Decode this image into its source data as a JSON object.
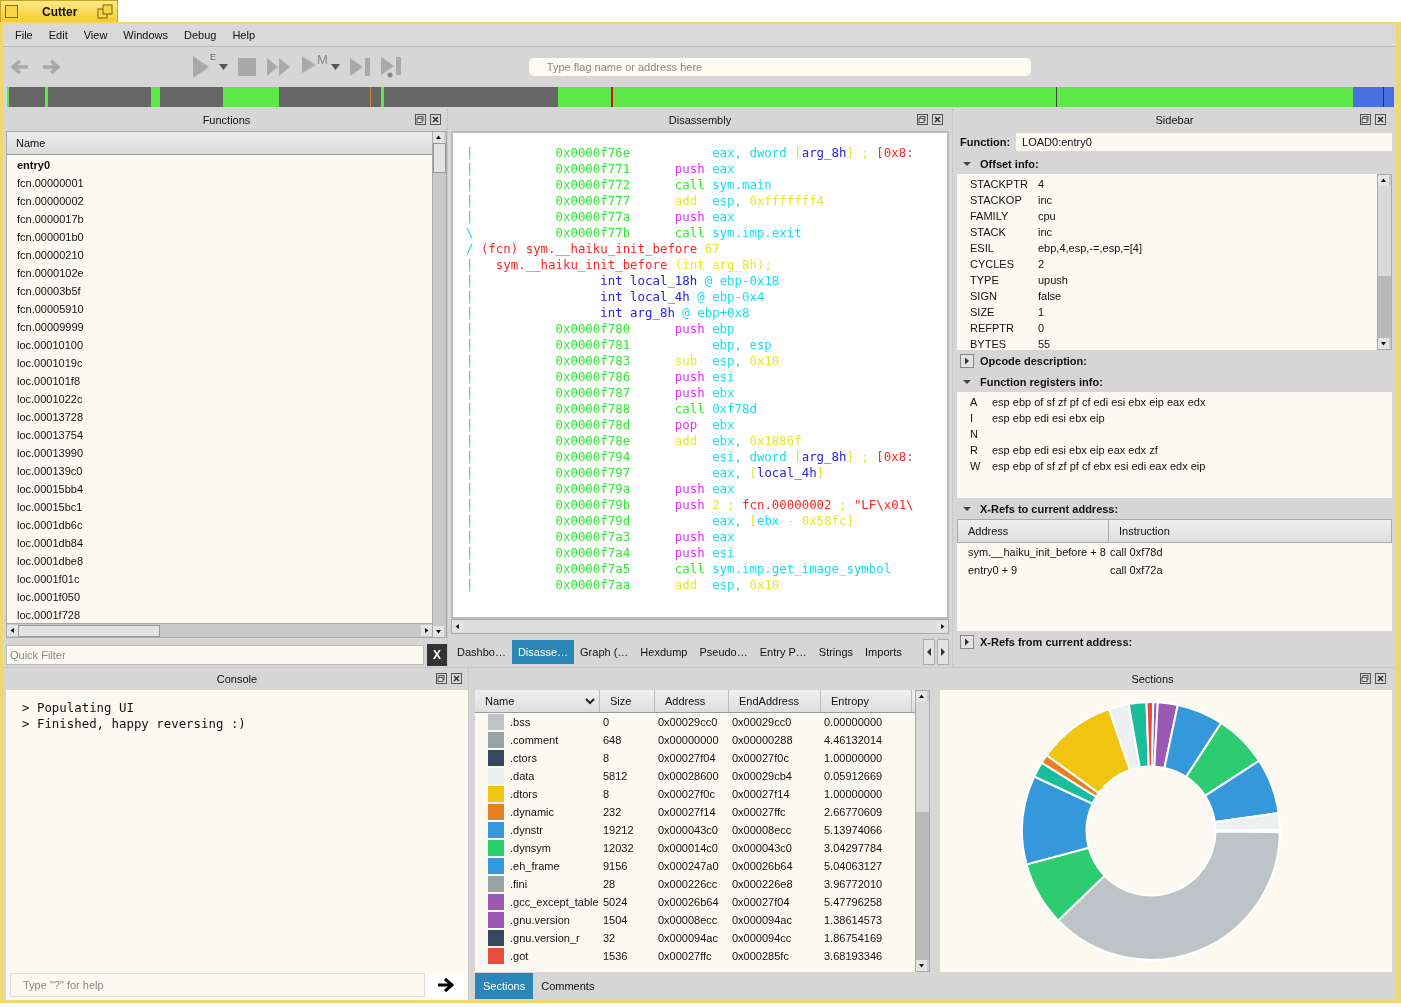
{
  "window": {
    "title": "Cutter"
  },
  "menu": [
    "File",
    "Edit",
    "View",
    "Windows",
    "Debug",
    "Help"
  ],
  "toolbar": {
    "run_badge": "E",
    "step_badge": "M",
    "search": {
      "placeholder": "Type flag name or address here"
    }
  },
  "functions": {
    "title": "Functions",
    "column": "Name",
    "items": [
      {
        "name": "entry0",
        "current": true
      },
      {
        "name": "fcn.00000001",
        "current": false
      },
      {
        "name": "fcn.00000002",
        "current": false
      },
      {
        "name": "fcn.0000017b",
        "current": false
      },
      {
        "name": "fcn.000001b0",
        "current": false
      },
      {
        "name": "fcn.00000210",
        "current": false
      },
      {
        "name": "fcn.0000102e",
        "current": false
      },
      {
        "name": "fcn.00003b5f",
        "current": false
      },
      {
        "name": "fcn.00005910",
        "current": false
      },
      {
        "name": "fcn.00009999",
        "current": false
      },
      {
        "name": "loc.00010100",
        "current": false
      },
      {
        "name": "loc.0001019c",
        "current": false
      },
      {
        "name": "loc.000101f8",
        "current": false
      },
      {
        "name": "loc.0001022c",
        "current": false
      },
      {
        "name": "loc.00013728",
        "current": false
      },
      {
        "name": "loc.00013754",
        "current": false
      },
      {
        "name": "loc.00013990",
        "current": false
      },
      {
        "name": "loc.000139c0",
        "current": false
      },
      {
        "name": "loc.00015bb4",
        "current": false
      },
      {
        "name": "loc.00015bc1",
        "current": false
      },
      {
        "name": "loc.0001db6c",
        "current": false
      },
      {
        "name": "loc.0001db84",
        "current": false
      },
      {
        "name": "loc.0001dbe8",
        "current": false
      },
      {
        "name": "loc.0001f01c",
        "current": false
      },
      {
        "name": "loc.0001f050",
        "current": false
      },
      {
        "name": "loc.0001f728",
        "current": false
      }
    ],
    "filter": {
      "placeholder": "Quick Filter"
    },
    "clear_button": "X"
  },
  "disassembly": {
    "title": "Disassembly",
    "lines": [
      {
        "kind": "instr",
        "gutter": "|",
        "addr": "0x0000f76e",
        "tokens": [
          {
            "text": "eax,",
            "kind": "reg"
          },
          {
            "text": "dword",
            "kind": "reg"
          },
          {
            "text": "[",
            "kind": "num"
          },
          {
            "text": "arg_8h",
            "kind": "var",
            "attached": true
          },
          {
            "text": "]",
            "kind": "num",
            "attached": true
          },
          {
            "text": ";",
            "kind": "num"
          },
          {
            "text": "[0x8:",
            "kind": "cmt"
          }
        ]
      },
      {
        "kind": "instr",
        "gutter": "|",
        "addr": "0x0000f771",
        "op": {
          "text": "push",
          "kind": "stack"
        },
        "tokens": [
          {
            "text": "eax",
            "kind": "reg"
          }
        ]
      },
      {
        "kind": "instr",
        "gutter": "|",
        "addr": "0x0000f772",
        "op": {
          "text": "call",
          "kind": "call"
        },
        "tokens": [
          {
            "text": "sym.main",
            "kind": "reg"
          }
        ]
      },
      {
        "kind": "instr",
        "gutter": "|",
        "addr": "0x0000f777",
        "op": {
          "text": "add",
          "kind": "arith"
        },
        "tokens": [
          {
            "text": "esp,",
            "kind": "reg"
          },
          {
            "text": "0xfffffff4",
            "kind": "num"
          }
        ]
      },
      {
        "kind": "instr",
        "gutter": "|",
        "addr": "0x0000f77a",
        "op": {
          "text": "push",
          "kind": "stack"
        },
        "tokens": [
          {
            "text": "eax",
            "kind": "reg"
          }
        ]
      },
      {
        "kind": "instr",
        "gutter": "\\",
        "addr": "0x0000f77b",
        "op": {
          "text": "call",
          "kind": "call"
        },
        "tokens": [
          {
            "text": "sym.imp.exit",
            "kind": "reg"
          }
        ]
      },
      {
        "kind": "header",
        "gutter": "/",
        "tokens": [
          {
            "text": "(fcn)",
            "kind": "cmt"
          },
          {
            "text": "sym.__haiku_init_before",
            "kind": "cmt"
          },
          {
            "text": "67",
            "kind": "num"
          }
        ]
      },
      {
        "kind": "signature",
        "gutter": "|",
        "tokens": [
          {
            "text": "sym.__haiku_init_before",
            "kind": "cmt"
          },
          {
            "text": "(int arg_8h);",
            "kind": "num"
          }
        ]
      },
      {
        "kind": "var",
        "gutter": "|",
        "tokens": [
          {
            "text": "int",
            "kind": "var"
          },
          {
            "text": "local_18h",
            "kind": "var"
          },
          {
            "text": "@",
            "kind": "reg"
          },
          {
            "text": "ebp-0x18",
            "kind": "reg"
          }
        ]
      },
      {
        "kind": "var",
        "gutter": "|",
        "tokens": [
          {
            "text": "int",
            "kind": "var"
          },
          {
            "text": "local_4h",
            "kind": "var"
          },
          {
            "text": "@",
            "kind": "reg"
          },
          {
            "text": "ebp-0x4",
            "kind": "reg"
          }
        ]
      },
      {
        "kind": "var",
        "gutter": "|",
        "tokens": [
          {
            "text": "int",
            "kind": "var"
          },
          {
            "text": "arg_8h",
            "kind": "var"
          },
          {
            "text": "@",
            "kind": "reg"
          },
          {
            "text": "ebp+0x8",
            "kind": "reg"
          }
        ]
      },
      {
        "kind": "instr",
        "gutter": "|",
        "addr": "0x0000f780",
        "op": {
          "text": "push",
          "kind": "stack"
        },
        "tokens": [
          {
            "text": "ebp",
            "kind": "reg"
          }
        ]
      },
      {
        "kind": "instr",
        "gutter": "|",
        "addr": "0x0000f781",
        "tokens": [
          {
            "text": "ebp,",
            "kind": "reg"
          },
          {
            "text": "esp",
            "kind": "reg"
          }
        ]
      },
      {
        "kind": "instr",
        "gutter": "|",
        "addr": "0x0000f783",
        "op": {
          "text": "sub",
          "kind": "arith"
        },
        "tokens": [
          {
            "text": "esp,",
            "kind": "reg"
          },
          {
            "text": "0x10",
            "kind": "num"
          }
        ]
      },
      {
        "kind": "instr",
        "gutter": "|",
        "addr": "0x0000f786",
        "op": {
          "text": "push",
          "kind": "stack"
        },
        "tokens": [
          {
            "text": "esi",
            "kind": "reg"
          }
        ]
      },
      {
        "kind": "instr",
        "gutter": "|",
        "addr": "0x0000f787",
        "op": {
          "text": "push",
          "kind": "stack"
        },
        "tokens": [
          {
            "text": "ebx",
            "kind": "reg"
          }
        ]
      },
      {
        "kind": "instr",
        "gutter": "|",
        "addr": "0x0000f788",
        "op": {
          "text": "call",
          "kind": "call"
        },
        "tokens": [
          {
            "text": "0xf78d",
            "kind": "reg"
          }
        ]
      },
      {
        "kind": "instr",
        "gutter": "|",
        "addr": "0x0000f78d",
        "op": {
          "text": "pop",
          "kind": "stack"
        },
        "tokens": [
          {
            "text": "ebx",
            "kind": "reg"
          }
        ]
      },
      {
        "kind": "instr",
        "gutter": "|",
        "addr": "0x0000f78e",
        "op": {
          "text": "add",
          "kind": "arith"
        },
        "tokens": [
          {
            "text": "ebx,",
            "kind": "reg"
          },
          {
            "text": "0x1886f",
            "kind": "num"
          }
        ]
      },
      {
        "kind": "instr",
        "gutter": "|",
        "addr": "0x0000f794",
        "tokens": [
          {
            "text": "esi,",
            "kind": "reg"
          },
          {
            "text": "dword",
            "kind": "reg"
          },
          {
            "text": "[",
            "kind": "num"
          },
          {
            "text": "arg_8h",
            "kind": "var",
            "attached": true
          },
          {
            "text": "]",
            "kind": "num",
            "attached": true
          },
          {
            "text": ";",
            "kind": "num"
          },
          {
            "text": "[0x8:",
            "kind": "cmt"
          }
        ]
      },
      {
        "kind": "instr",
        "gutter": "|",
        "addr": "0x0000f797",
        "tokens": [
          {
            "text": "eax,",
            "kind": "reg"
          },
          {
            "text": "[",
            "kind": "num"
          },
          {
            "text": "local_4h",
            "kind": "var",
            "attached": true
          },
          {
            "text": "]",
            "kind": "num",
            "attached": true
          }
        ]
      },
      {
        "kind": "instr",
        "gutter": "|",
        "addr": "0x0000f79a",
        "op": {
          "text": "push",
          "kind": "stack"
        },
        "tokens": [
          {
            "text": "eax",
            "kind": "reg"
          }
        ]
      },
      {
        "kind": "instr",
        "gutter": "|",
        "addr": "0x0000f79b",
        "op": {
          "text": "push",
          "kind": "stack"
        },
        "tokens": [
          {
            "text": "2",
            "kind": "num"
          },
          {
            "text": ";",
            "kind": "num"
          },
          {
            "text": "fcn.00000002",
            "kind": "cmt"
          },
          {
            "text": ";",
            "kind": "num"
          },
          {
            "text": "\"LF\\x01\\",
            "kind": "cmt"
          }
        ]
      },
      {
        "kind": "instr",
        "gutter": "|",
        "addr": "0x0000f79d",
        "tokens": [
          {
            "text": "eax,",
            "kind": "reg"
          },
          {
            "text": "[",
            "kind": "num"
          },
          {
            "text": "ebx",
            "kind": "reg",
            "attached": true
          },
          {
            "text": "-",
            "kind": "num"
          },
          {
            "text": "0x58fc",
            "kind": "num"
          },
          {
            "text": "]",
            "kind": "num",
            "attached": true
          }
        ]
      },
      {
        "kind": "instr",
        "gutter": "|",
        "addr": "0x0000f7a3",
        "op": {
          "text": "push",
          "kind": "stack"
        },
        "tokens": [
          {
            "text": "eax",
            "kind": "reg"
          }
        ]
      },
      {
        "kind": "instr",
        "gutter": "|",
        "addr": "0x0000f7a4",
        "op": {
          "text": "push",
          "kind": "stack"
        },
        "tokens": [
          {
            "text": "esi",
            "kind": "reg"
          }
        ]
      },
      {
        "kind": "instr",
        "gutter": "|",
        "addr": "0x0000f7a5",
        "op": {
          "text": "call",
          "kind": "call"
        },
        "tokens": [
          {
            "text": "sym.imp.get_image_symbol",
            "kind": "reg"
          }
        ]
      },
      {
        "kind": "instr",
        "gutter": "|",
        "addr": "0x0000f7aa",
        "op": {
          "text": "add",
          "kind": "arith"
        },
        "tokens": [
          {
            "text": "esp,",
            "kind": "reg"
          },
          {
            "text": "0x10",
            "kind": "num"
          }
        ]
      }
    ],
    "tabs": [
      {
        "label": "Dashbo…",
        "selected": false
      },
      {
        "label": "Disasse…",
        "selected": true
      },
      {
        "label": "Graph (…",
        "selected": false
      },
      {
        "label": "Hexdump",
        "selected": false
      },
      {
        "label": "Pseudo…",
        "selected": false
      },
      {
        "label": "Entry P…",
        "selected": false
      },
      {
        "label": "Strings",
        "selected": false
      },
      {
        "label": "Imports",
        "selected": false
      }
    ]
  },
  "sidebar": {
    "title": "Sidebar",
    "function_label": "Function:",
    "function_value": "LOAD0:entry0",
    "offset_info": {
      "title": "Offset info:",
      "expanded": true,
      "rows": [
        [
          "STACKPTR",
          "4"
        ],
        [
          "STACKOP",
          "inc"
        ],
        [
          "FAMILY",
          "cpu"
        ],
        [
          "STACK",
          "inc"
        ],
        [
          "ESIL",
          "ebp,4,esp,-=,esp,=[4]"
        ],
        [
          "CYCLES",
          "2"
        ],
        [
          "TYPE",
          "upush"
        ],
        [
          "SIGN",
          "false"
        ],
        [
          "SIZE",
          "1"
        ],
        [
          "REFPTR",
          "0"
        ],
        [
          "BYTES",
          "55"
        ]
      ]
    },
    "opcode_description": {
      "title": "Opcode description:",
      "expanded": false
    },
    "registers_info": {
      "title": "Function registers info:",
      "expanded": true,
      "rows": [
        [
          "A",
          "esp ebp of sf zf pf cf edi esi ebx eip eax edx"
        ],
        [
          "I",
          "esp ebp edi esi ebx eip"
        ],
        [
          "N",
          ""
        ],
        [
          "R",
          "esp ebp edi esi ebx eip eax edx zf"
        ],
        [
          "W",
          "esp ebp of sf zf pf cf ebx esi edi eax edx eip"
        ]
      ]
    },
    "xrefs_to": {
      "title": "X-Refs to current address:",
      "expanded": true,
      "columns": [
        "Address",
        "Instruction"
      ],
      "rows": [
        [
          "sym.__haiku_init_before + 8",
          "call 0xf78d"
        ],
        [
          "entry0 + 9",
          "call 0xf72a"
        ]
      ]
    },
    "xrefs_from": {
      "title": "X-Refs from current address:",
      "expanded": false
    }
  },
  "console": {
    "title": "Console",
    "lines": [
      {
        "prompt": ">",
        "text": "Populating UI"
      },
      {
        "prompt": ">",
        "text": "Finished, happy reversing :)"
      }
    ],
    "input": {
      "placeholder": "Type \"?\" for help"
    }
  },
  "sections": {
    "title": "Sections",
    "columns": [
      "Name",
      "Size",
      "Address",
      "EndAddress",
      "Entropy"
    ],
    "rows": [
      {
        "color": "#bdc3c7",
        "name": ".bss",
        "size": "0",
        "address": "0x00029cc0",
        "end": "0x00029cc0",
        "entropy": "0.00000000"
      },
      {
        "color": "#95a5a6",
        "name": ".comment",
        "size": "648",
        "address": "0x00000000",
        "end": "0x00000288",
        "entropy": "4.46132014"
      },
      {
        "color": "#34495e",
        "name": ".ctors",
        "size": "8",
        "address": "0x00027f04",
        "end": "0x00027f0c",
        "entropy": "1.00000000"
      },
      {
        "color": "#ecf0f1",
        "name": ".data",
        "size": "5812",
        "address": "0x00028600",
        "end": "0x00029cb4",
        "entropy": "0.05912669"
      },
      {
        "color": "#f1c40f",
        "name": ".dtors",
        "size": "8",
        "address": "0x00027f0c",
        "end": "0x00027f14",
        "entropy": "1.00000000"
      },
      {
        "color": "#e67e22",
        "name": ".dynamic",
        "size": "232",
        "address": "0x00027f14",
        "end": "0x00027ffc",
        "entropy": "2.66770609"
      },
      {
        "color": "#3498db",
        "name": ".dynstr",
        "size": "19212",
        "address": "0x000043c0",
        "end": "0x00008ecc",
        "entropy": "5.13974066"
      },
      {
        "color": "#2ecc71",
        "name": ".dynsym",
        "size": "12032",
        "address": "0x000014c0",
        "end": "0x000043c0",
        "entropy": "3.04297784"
      },
      {
        "color": "#3498db",
        "name": ".eh_frame",
        "size": "9156",
        "address": "0x000247a0",
        "end": "0x00026b64",
        "entropy": "5.04063127"
      },
      {
        "color": "#95a5a6",
        "name": ".fini",
        "size": "28",
        "address": "0x000226cc",
        "end": "0x000226e8",
        "entropy": "3.96772010"
      },
      {
        "color": "#9b59b6",
        "name": ".gcc_except_table",
        "size": "5024",
        "address": "0x00026b64",
        "end": "0x00027f04",
        "entropy": "5.47796258"
      },
      {
        "color": "#9b59b6",
        "name": ".gnu.version",
        "size": "1504",
        "address": "0x00008ecc",
        "end": "0x000094ac",
        "entropy": "1.38614573"
      },
      {
        "color": "#34495e",
        "name": ".gnu.version_r",
        "size": "32",
        "address": "0x000094ac",
        "end": "0x000094cc",
        "entropy": "1.86754169"
      },
      {
        "color": "#e74c3c",
        "name": ".got",
        "size": "1536",
        "address": "0x00027ffc",
        "end": "0x000285fc",
        "entropy": "3.68193346"
      }
    ],
    "tabs": [
      {
        "label": "Sections",
        "selected": true
      },
      {
        "label": "Comments",
        "selected": false
      }
    ]
  }
}
